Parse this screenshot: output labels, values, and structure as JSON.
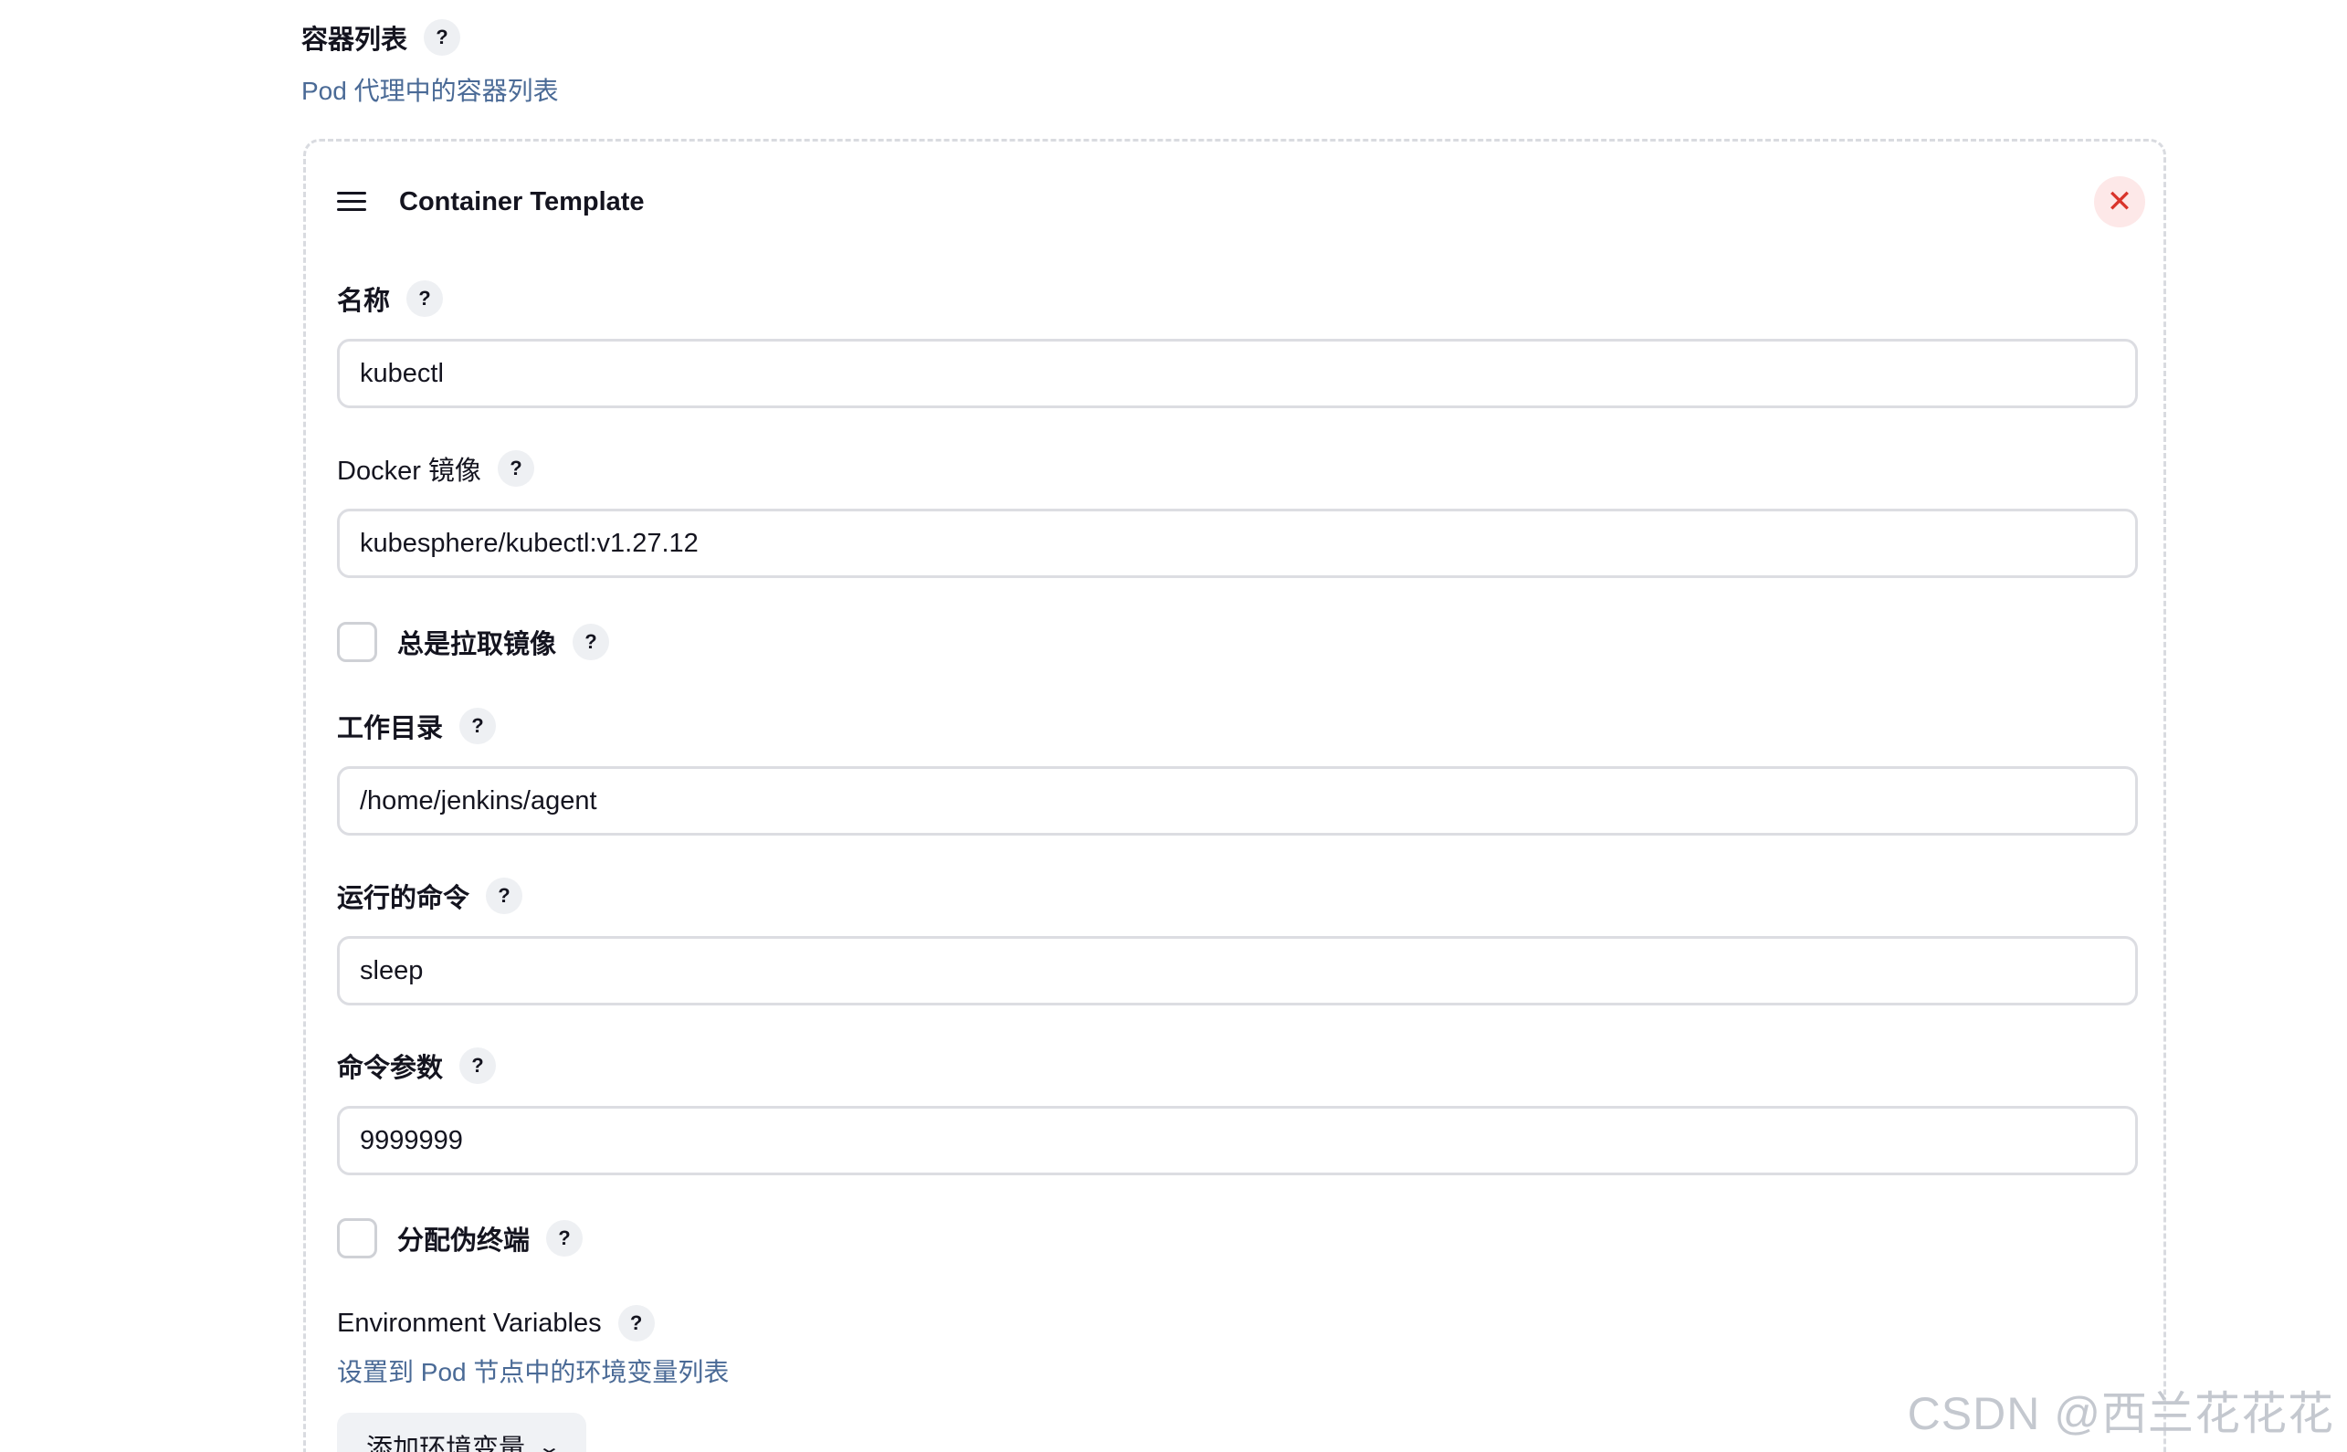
{
  "section": {
    "title": "容器列表",
    "description": "Pod 代理中的容器列表",
    "help": "?"
  },
  "card": {
    "title": "Container Template",
    "close": "✕"
  },
  "fields": {
    "name": {
      "label": "名称",
      "value": "kubectl"
    },
    "image": {
      "label": "Docker 镜像",
      "value": "kubesphere/kubectl:v1.27.12"
    },
    "always_pull": {
      "label": "总是拉取镜像",
      "checked": false
    },
    "workdir": {
      "label": "工作目录",
      "value": "/home/jenkins/agent"
    },
    "command": {
      "label": "运行的命令",
      "value": "sleep"
    },
    "args": {
      "label": "命令参数",
      "value": "9999999"
    },
    "tty": {
      "label": "分配伪终端",
      "checked": false
    }
  },
  "env": {
    "label": "Environment Variables",
    "description": "设置到 Pod 节点中的环境变量列表",
    "add_button": "添加环境变量",
    "add_icon": "chevron-down-icon"
  },
  "watermark": "CSDN @西兰花花花"
}
